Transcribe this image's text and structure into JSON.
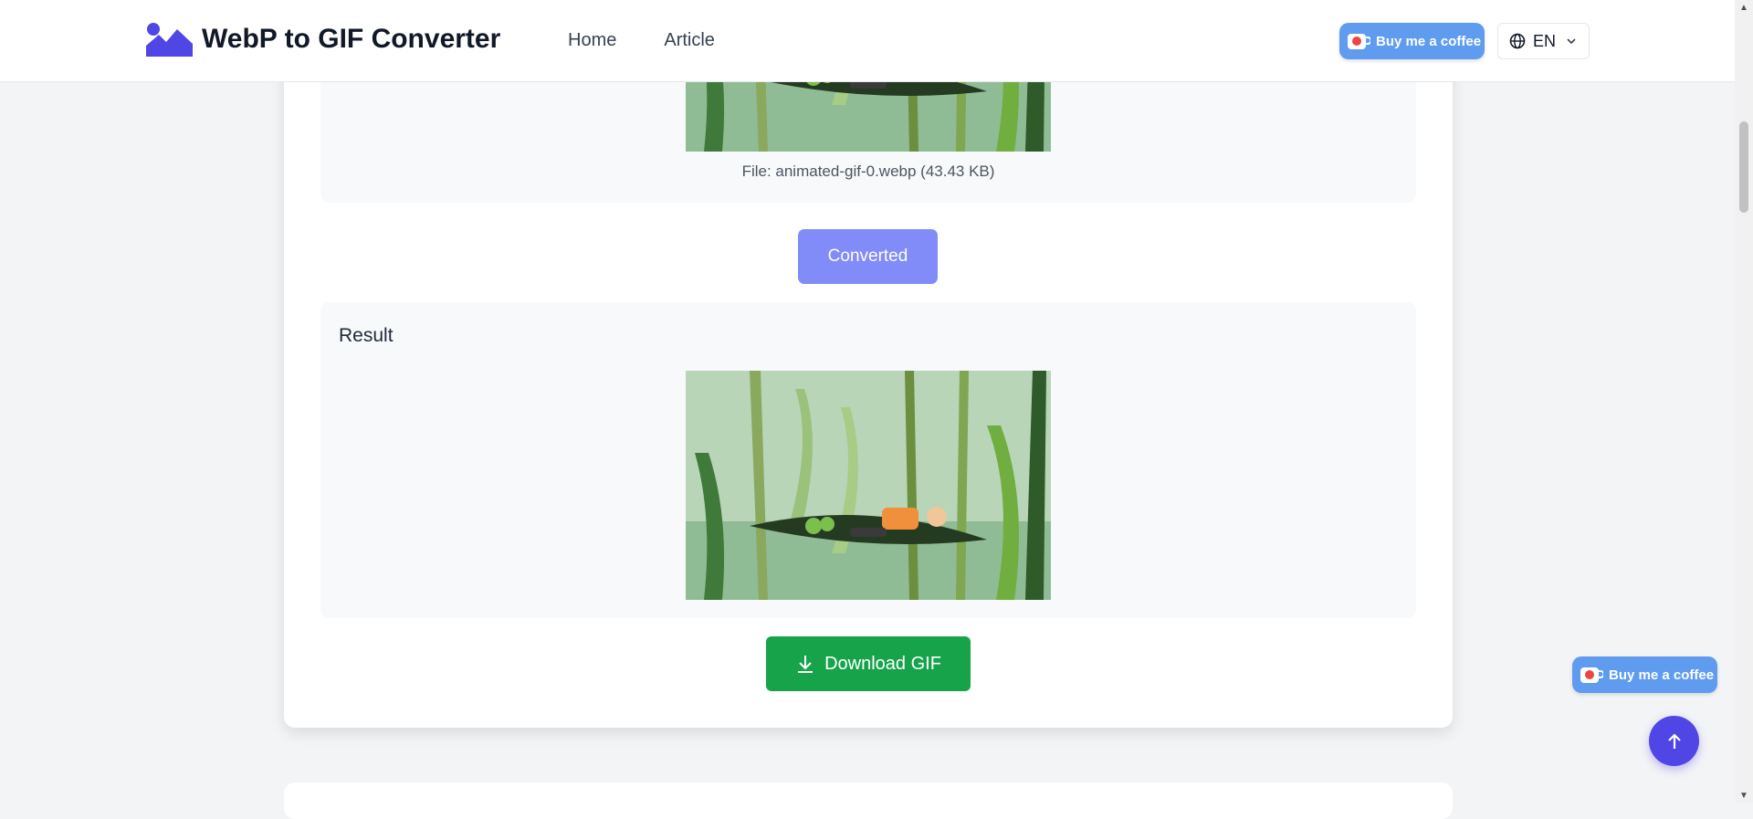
{
  "app": {
    "title": "WebP to GIF Converter"
  },
  "nav": {
    "items": [
      {
        "label": "Home"
      },
      {
        "label": "Article"
      }
    ]
  },
  "header": {
    "coffee_label": "Buy me a coffee",
    "lang_label": "EN"
  },
  "source": {
    "file_info": "File: animated-gif-0.webp (43.43 KB)"
  },
  "actions": {
    "converted_label": "Converted",
    "download_label": "Download GIF"
  },
  "result": {
    "title": "Result"
  },
  "floating": {
    "coffee_label": "Buy me a coffee"
  },
  "colors": {
    "accent": "#4f46e5",
    "converted_button": "#818cf8",
    "download_button": "#16a34a",
    "coffee_button": "#5f9cf0",
    "page_background": "#f3f4f6"
  },
  "icons": [
    "logo-mountain-icon",
    "coffee-cup-icon",
    "globe-icon",
    "chevron-down-icon",
    "download-icon",
    "arrow-up-icon"
  ]
}
